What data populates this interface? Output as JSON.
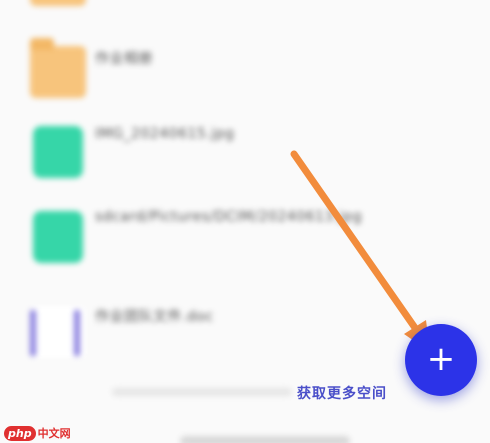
{
  "files": [
    {
      "type": "folder",
      "name": "作业相册",
      "meta": ""
    },
    {
      "type": "image",
      "name": "IMG_20240615.jpg",
      "meta": ""
    },
    {
      "type": "image",
      "name": "sdcard/Pictures/DCIM/20240613.jpg",
      "meta": ""
    },
    {
      "type": "other",
      "name": "作业团队文件.doc",
      "meta": ""
    }
  ],
  "get_space": "获取更多空间",
  "fab": {
    "icon": "plus-icon",
    "label": "+"
  },
  "watermark": {
    "badge": "php",
    "site": "中文网"
  },
  "colors": {
    "fab": "#2c33e8",
    "arrow": "#f28c3c",
    "link": "#4a4fc9",
    "folder": "#f7c47c",
    "image": "#36d6a8"
  }
}
